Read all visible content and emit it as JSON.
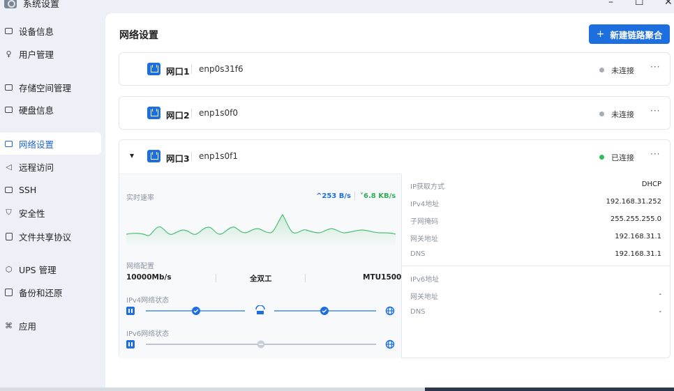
{
  "window": {
    "title": "系统设置",
    "controls": {
      "minimize": "–",
      "maximize": "☐",
      "close": "✕"
    }
  },
  "sidebar": {
    "items": [
      {
        "label": "设备信息",
        "icon": "monitor-icon",
        "active": false
      },
      {
        "label": "用户管理",
        "icon": "user-icon",
        "active": false
      },
      {
        "label": "存储空间管理",
        "icon": "storage-icon",
        "active": false
      },
      {
        "label": "硬盘信息",
        "icon": "disk-icon",
        "active": false
      },
      {
        "label": "网络设置",
        "icon": "network-icon",
        "active": true
      },
      {
        "label": "远程访问",
        "icon": "send-icon",
        "active": false
      },
      {
        "label": "SSH",
        "icon": "terminal-icon",
        "active": false
      },
      {
        "label": "安全性",
        "icon": "shield-icon",
        "active": false
      },
      {
        "label": "文件共享协议",
        "icon": "document-icon",
        "active": false
      },
      {
        "label": "UPS 管理",
        "icon": "ups-icon",
        "active": false
      },
      {
        "label": "备份和还原",
        "icon": "save-icon",
        "active": false
      },
      {
        "label": "应用",
        "icon": "apps-icon",
        "active": false
      }
    ]
  },
  "header": {
    "title": "网络设置",
    "new_button": "新建链路聚合",
    "new_button_icon": "plus-icon"
  },
  "ports": [
    {
      "name": "网口1",
      "device": "enp0s31f6",
      "status": "未连接",
      "more": "···"
    },
    {
      "name": "网口2",
      "device": "enp1s0f0",
      "status": "未连接",
      "more": "···"
    },
    {
      "name": "网口3",
      "device": "enp1s0f1",
      "status": "已连接",
      "more": "···"
    }
  ],
  "details": {
    "realtime_label": "实时速率",
    "upload": "^253 B/s",
    "download": "˅6.8 KB/s",
    "net_config_label": "网络配置",
    "speed": "10000Mb/s",
    "duplex": "全双工",
    "mtu": "MTU1500",
    "ipv4_status_label": "IPv4网络状态",
    "ipv6_status_label": "IPv6网络状态",
    "ipv4": [
      {
        "key": "IP获取方式",
        "value": "DHCP"
      },
      {
        "key": "IPv4地址",
        "value": "192.168.31.252"
      },
      {
        "key": "子网掩码",
        "value": "255.255.255.0"
      },
      {
        "key": "网关地址",
        "value": "192.168.31.1"
      },
      {
        "key": "DNS",
        "value": "192.168.31.1"
      }
    ],
    "ipv6": [
      {
        "key": "IPv6地址",
        "value": ""
      },
      {
        "key": "网关地址",
        "value": "-"
      },
      {
        "key": "DNS",
        "value": "-"
      }
    ]
  },
  "colors": {
    "accent": "#1d6fe0",
    "connected": "#2ebd59",
    "disconnected": "#a6adb8",
    "download_line": "#4cbf73"
  }
}
